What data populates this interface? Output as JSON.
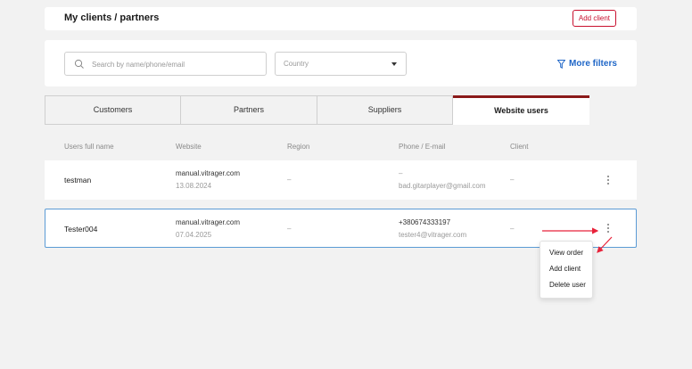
{
  "header": {
    "title": "My clients / partners",
    "add_client_label": "Add client"
  },
  "filters": {
    "search_placeholder": "Search by name/phone/email",
    "country_label": "Country",
    "more_filters_label": "More filters"
  },
  "tabs": [
    {
      "label": "Customers",
      "active": false
    },
    {
      "label": "Partners",
      "active": false
    },
    {
      "label": "Suppliers",
      "active": false
    },
    {
      "label": "Website users",
      "active": true
    }
  ],
  "table": {
    "columns": [
      "Users full name",
      "Website",
      "Region",
      "Phone / E-mail",
      "Client"
    ],
    "rows": [
      {
        "name": "testman",
        "website": "manual.vitrager.com",
        "date": "13.08.2024",
        "region": "–",
        "phone": "–",
        "email": "bad.gitarplayer@gmail.com",
        "client": "–"
      },
      {
        "name": "Tester004",
        "website": "manual.vitrager.com",
        "date": "07.04.2025",
        "region": "–",
        "phone": "+380674333197",
        "email": "tester4@vitrager.com",
        "client": "–"
      }
    ]
  },
  "context_menu": {
    "items": [
      "View order",
      "Add client",
      "Delete user"
    ]
  },
  "colors": {
    "accent_red": "#c8102e",
    "link_blue": "#1f66c7",
    "row_highlight": "#5b9bd5",
    "tab_active_border": "#8b1a1a"
  }
}
